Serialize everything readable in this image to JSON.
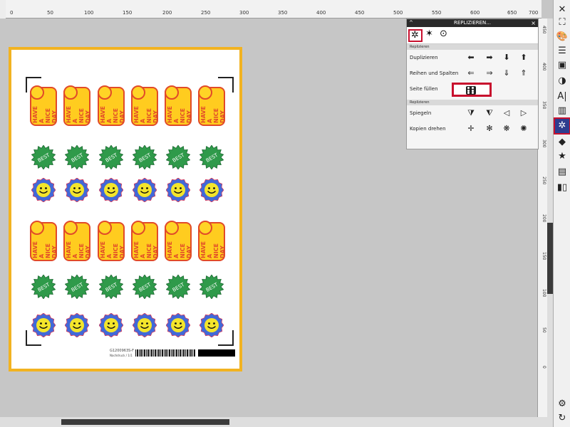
{
  "ruler": {
    "top_labels": [
      "0",
      "50",
      "100",
      "150",
      "200",
      "250",
      "300",
      "350",
      "400",
      "450",
      "500",
      "550",
      "600",
      "650",
      "700"
    ],
    "right_labels": [
      "450",
      "400",
      "350",
      "300",
      "250",
      "200",
      "150",
      "100",
      "50",
      "0"
    ]
  },
  "canvas": {
    "sticker_badge_text": "HAVE A NICE DAY",
    "seal_text": "BEST",
    "barcode_text_line1": "G1200963S-F",
    "barcode_text_line2": "Nachdruck / 1/1"
  },
  "panel": {
    "title": "REPLIZIEREN...",
    "close": "×",
    "collapse": "^",
    "tabs": [
      {
        "icon": "replicate-icon",
        "active": true
      },
      {
        "icon": "magic-replicate-icon",
        "active": false
      },
      {
        "icon": "rotate-replicate-icon",
        "active": false
      }
    ],
    "section1_label": "Replizieren",
    "rows1": [
      {
        "label": "Duplizieren"
      },
      {
        "label": "Reihen und Spalten"
      },
      {
        "label": "Seite füllen"
      }
    ],
    "section2_label": "Replizieren",
    "rows2": [
      {
        "label": "Spiegeln"
      },
      {
        "label": "Kopien drehen"
      }
    ]
  },
  "toolbar": {
    "items": [
      "close-panel",
      "fullscreen",
      "palette",
      "layers",
      "contrast",
      "text",
      "align",
      "replicate",
      "fill",
      "star",
      "page",
      "barcode",
      "settings",
      "refresh"
    ]
  },
  "colors": {
    "page_border": "#f2b321",
    "highlight": "#c8102e",
    "active_tool": "#2e3d8f",
    "badge": "#ffcc1f",
    "badge_stroke": "#e14a29",
    "seal": "#2f9a4a",
    "sun_outer": "#4169d8",
    "sun_inner": "#f4e52b"
  }
}
